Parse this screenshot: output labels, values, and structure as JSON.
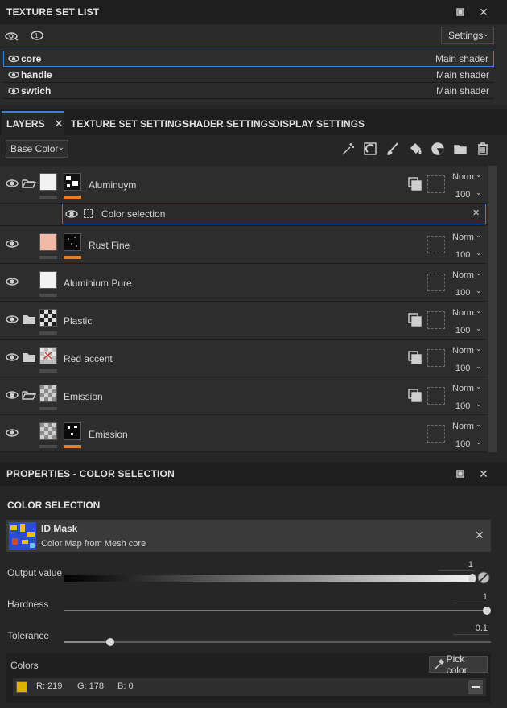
{
  "texture_set_list": {
    "title": "TEXTURE SET LIST",
    "settings_label": "Settings",
    "items": [
      {
        "name": "core",
        "shader": "Main shader"
      },
      {
        "name": "handle",
        "shader": "Main shader"
      },
      {
        "name": "swtich",
        "shader": "Main shader"
      }
    ]
  },
  "tabs": {
    "layers": "LAYERS",
    "texture_set_settings": "TEXTURE SET SETTINGS",
    "shader_settings": "SHADER SETTINGS",
    "display_settings": "DISPLAY SETTINGS"
  },
  "layers": {
    "channel": "Base Color",
    "rows": [
      {
        "name": "Aluminuym",
        "blend": "Norm",
        "opacity": "100"
      },
      {
        "name": "Color selection"
      },
      {
        "name": "Rust Fine",
        "blend": "Norm",
        "opacity": "100"
      },
      {
        "name": "Aluminium Pure",
        "blend": "Norm",
        "opacity": "100"
      },
      {
        "name": "Plastic",
        "blend": "Norm",
        "opacity": "100"
      },
      {
        "name": "Red accent",
        "blend": "Norm",
        "opacity": "100"
      },
      {
        "name": "Emission",
        "blend": "Norm",
        "opacity": "100"
      },
      {
        "name": "Emission",
        "blend": "Norm",
        "opacity": "100"
      }
    ]
  },
  "properties": {
    "title": "PROPERTIES - COLOR SELECTION",
    "section": "COLOR SELECTION",
    "mask_title": "ID Mask",
    "mask_subtitle": "Color Map from Mesh core",
    "output_label": "Output value",
    "output_value": "1",
    "hardness_label": "Hardness",
    "hardness_value": "1",
    "tolerance_label": "Tolerance",
    "tolerance_value": "0.1",
    "colors_label": "Colors",
    "pick_color_label": "Pick color",
    "color_r": "R: 219",
    "color_g": "G: 178",
    "color_b": "B: 0",
    "swatch_color": "#dbb200"
  }
}
